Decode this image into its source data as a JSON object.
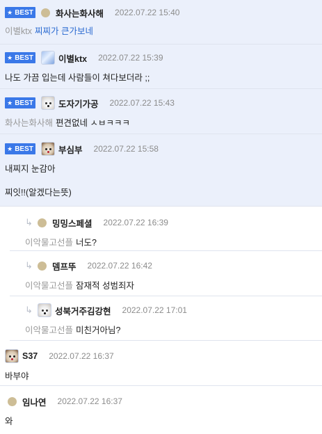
{
  "best_badge": "BEST",
  "comments": [
    {
      "nick": "화사는화사해",
      "date": "2022.07.22 15:40",
      "mention": "이별ktx",
      "text": "찌찌가 큰가보네"
    },
    {
      "nick": "이별ktx",
      "date": "2022.07.22 15:39",
      "text": "나도 가끔 입는데 사람들이 쳐다보더라 ;;"
    },
    {
      "nick": "도자기가공",
      "date": "2022.07.22 15:43",
      "mention": "화사는화사해",
      "text": "편견없네 ㅅㅂㅋㅋㅋ"
    },
    {
      "nick": "부심부",
      "date": "2022.07.22 15:58",
      "text": "내찌지 눈감아",
      "text2": "찌잇!!(알겠다는뜻)"
    },
    {
      "nick": "밍밍스페셜",
      "date": "2022.07.22 16:39",
      "mention": "이악물고선플",
      "text": "너도?"
    },
    {
      "nick": "뎀프뚜",
      "date": "2022.07.22 16:42",
      "mention": "이악물고선플",
      "text": "잠재적 성범죄자"
    },
    {
      "nick": "성북거주김강현",
      "date": "2022.07.22 17:01",
      "mention": "이악물고선플",
      "text": "미친거아님?"
    },
    {
      "nick": "S37",
      "date": "2022.07.22 16:37",
      "text": "바부야"
    },
    {
      "nick": "임나연",
      "date": "2022.07.22 16:37",
      "text": "와"
    }
  ],
  "icons": {
    "star": "star-icon",
    "reply": "reply-arrow-icon",
    "avatar": "avatar"
  },
  "colors": {
    "best_bg": "#ebf0fb",
    "badge": "#3a78e8",
    "link": "#2a6ad1"
  }
}
